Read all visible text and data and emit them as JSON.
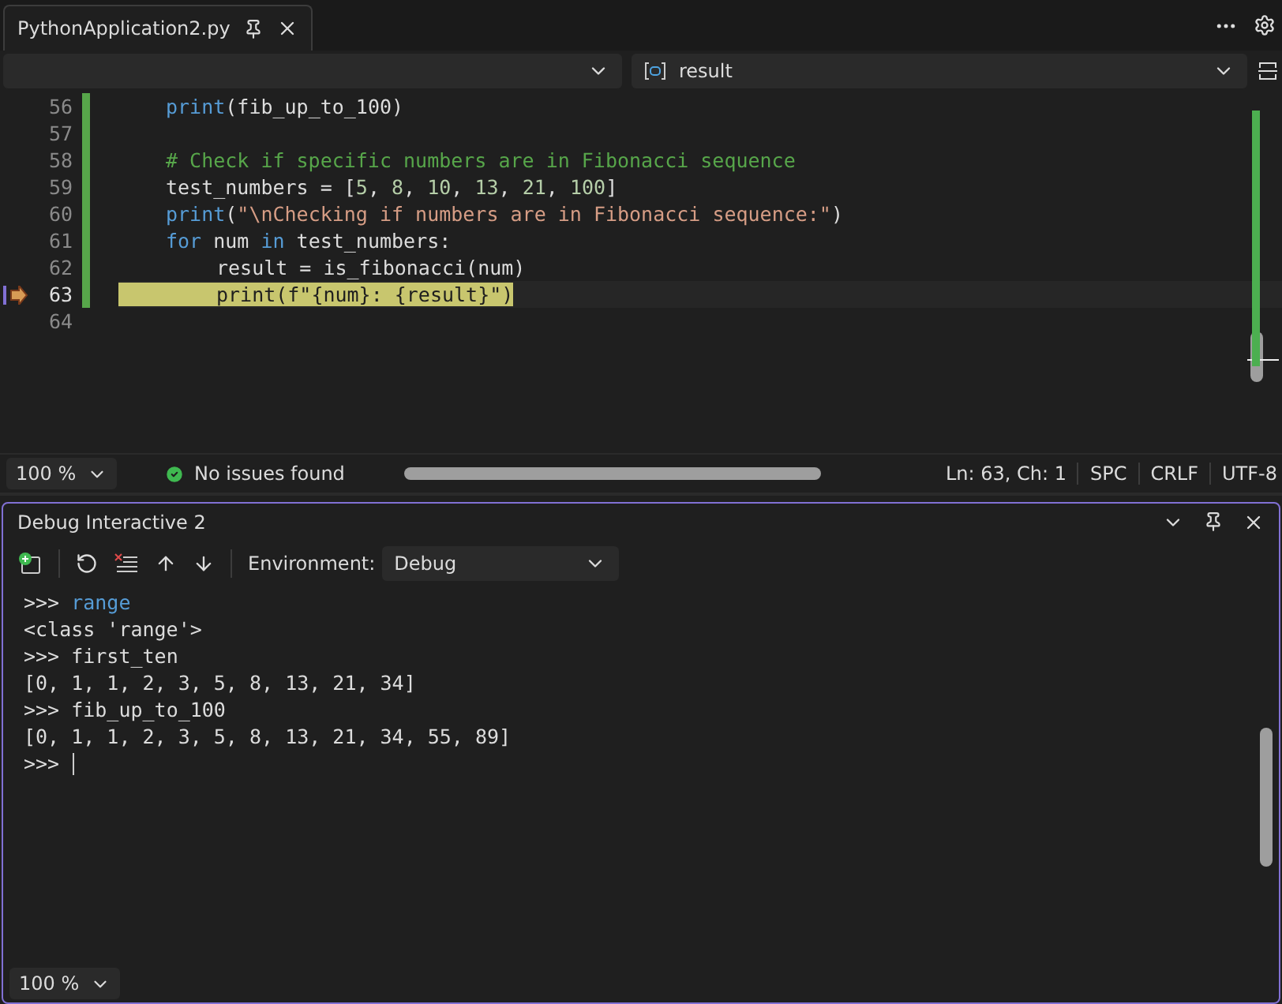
{
  "tab": {
    "title": "PythonApplication2.py"
  },
  "navigation": {
    "member": "result"
  },
  "editor": {
    "lines": [
      {
        "number": "56",
        "changed": true,
        "current": false,
        "tokens": [
          {
            "kind": "fn",
            "text": "print"
          },
          {
            "kind": "plain",
            "text": "(fib_up_to_100)"
          }
        ]
      },
      {
        "number": "57",
        "changed": true,
        "current": false
      },
      {
        "number": "58",
        "changed": true,
        "current": false,
        "tokens": [
          {
            "kind": "comment",
            "text": "# Check if specific numbers are in Fibonacci sequence"
          }
        ]
      },
      {
        "number": "59",
        "changed": true,
        "current": false,
        "tokens": [
          {
            "kind": "plain",
            "text": "test_numbers = ["
          },
          {
            "kind": "num",
            "text": "5"
          },
          {
            "kind": "plain",
            "text": ", "
          },
          {
            "kind": "num",
            "text": "8"
          },
          {
            "kind": "plain",
            "text": ", "
          },
          {
            "kind": "num",
            "text": "10"
          },
          {
            "kind": "plain",
            "text": ", "
          },
          {
            "kind": "num",
            "text": "13"
          },
          {
            "kind": "plain",
            "text": ", "
          },
          {
            "kind": "num",
            "text": "21"
          },
          {
            "kind": "plain",
            "text": ", "
          },
          {
            "kind": "num",
            "text": "100"
          },
          {
            "kind": "plain",
            "text": "]"
          }
        ]
      },
      {
        "number": "60",
        "changed": true,
        "current": false,
        "tokens": [
          {
            "kind": "fn",
            "text": "print"
          },
          {
            "kind": "plain",
            "text": "("
          },
          {
            "kind": "str",
            "text": "\"\\nChecking if numbers are in Fibonacci sequence:\""
          },
          {
            "kind": "plain",
            "text": ")"
          }
        ]
      },
      {
        "number": "61",
        "changed": true,
        "current": false,
        "tokens": [
          {
            "kind": "kw",
            "text": "for"
          },
          {
            "kind": "plain",
            "text": " num "
          },
          {
            "kind": "kw",
            "text": "in"
          },
          {
            "kind": "plain",
            "text": " test_numbers:"
          }
        ]
      },
      {
        "number": "62",
        "changed": true,
        "current": false,
        "indent": true,
        "tokens": [
          {
            "kind": "plain",
            "text": "result = is_fibonacci(num)"
          }
        ]
      },
      {
        "number": "63",
        "changed": true,
        "current": true,
        "indent": true,
        "tokens": [
          {
            "kind": "plain",
            "text": "print(f\"{num}: {result}\")"
          }
        ]
      },
      {
        "number": "64",
        "changed": false,
        "current": false
      }
    ]
  },
  "status_bar": {
    "zoom": "100 %",
    "issues": "No issues found",
    "position": "Ln: 63, Ch: 1",
    "indent": "SPC",
    "line_ending": "CRLF",
    "encoding": "UTF-8"
  },
  "debug_panel": {
    "title": "Debug Interactive 2",
    "environment_label": "Environment:",
    "environment": "Debug",
    "console": [
      {
        "kind": "input",
        "prompt": ">>>",
        "text": "range",
        "highlight": true
      },
      {
        "kind": "output",
        "text": "<class 'range'>"
      },
      {
        "kind": "input",
        "prompt": ">>>",
        "text": "first_ten",
        "highlight": false
      },
      {
        "kind": "output",
        "text": "[0, 1, 1, 2, 3, 5, 8, 13, 21, 34]"
      },
      {
        "kind": "input",
        "prompt": ">>>",
        "text": "fib_up_to_100",
        "highlight": false
      },
      {
        "kind": "output",
        "text": "[0, 1, 1, 2, 3, 5, 8, 13, 21, 34, 55, 89]"
      },
      {
        "kind": "prompt",
        "prompt": ">>>"
      }
    ],
    "zoom": "100 %"
  }
}
